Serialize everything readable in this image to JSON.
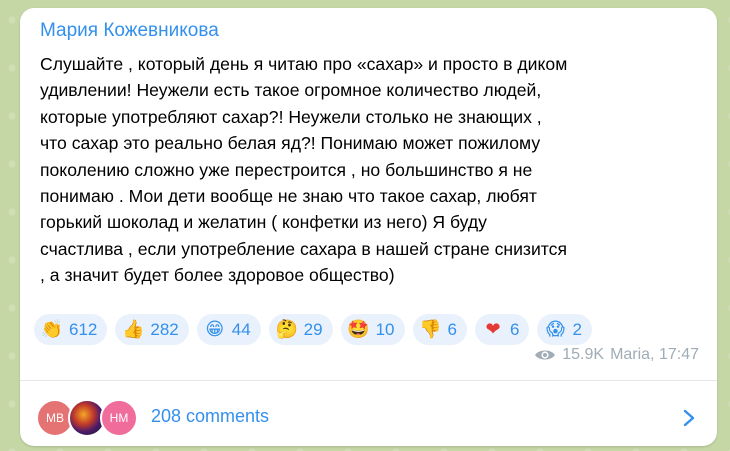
{
  "post": {
    "author": "Мария Кожевникова",
    "text": "Слушайте , который день я читаю про «сахар» и просто в диком\nудивлении! Неужели есть такое огромное количество людей,\nкоторые употребляют сахар?! Неужели столько не знающих ,\nчто сахар это реально белая яд?! Понимаю может пожилому\nпоколению сложно уже перестроится , но большинство я не\nпонимаю . Мои дети вообще не знаю что такое сахар, любят\nгорький шоколад и желатин ( конфетки из него) Я буду\nсчастлива , если употребление сахара в нашей стране снизится\n, а значит будет более здоровое общество)"
  },
  "reactions": [
    {
      "emoji": "👏",
      "icon": "clapping-hands-icon",
      "count": "612"
    },
    {
      "emoji": "👍",
      "icon": "thumbs-up-icon",
      "count": "282"
    },
    {
      "emoji": "😁",
      "icon": "grinning-face-icon",
      "count": "44"
    },
    {
      "emoji": "🤔",
      "icon": "thinking-face-icon",
      "count": "29"
    },
    {
      "emoji": "🤩",
      "icon": "star-struck-icon",
      "count": "10"
    },
    {
      "emoji": "👎",
      "icon": "thumbs-down-icon",
      "count": "6"
    },
    {
      "emoji": "❤",
      "icon": "red-heart-icon",
      "count": "6"
    },
    {
      "emoji": "😱",
      "icon": "screaming-face-icon",
      "count": "2"
    }
  ],
  "meta": {
    "views": "15.9K",
    "signature": "Maria, 17:47"
  },
  "comments": {
    "avatars": [
      "МВ",
      "",
      "НМ"
    ],
    "label": "208 comments"
  },
  "colors": {
    "accent": "#3390ec",
    "reaction_bg": "#e8f1fc",
    "meta": "#a0acb6",
    "background": "#c6d7a6"
  }
}
